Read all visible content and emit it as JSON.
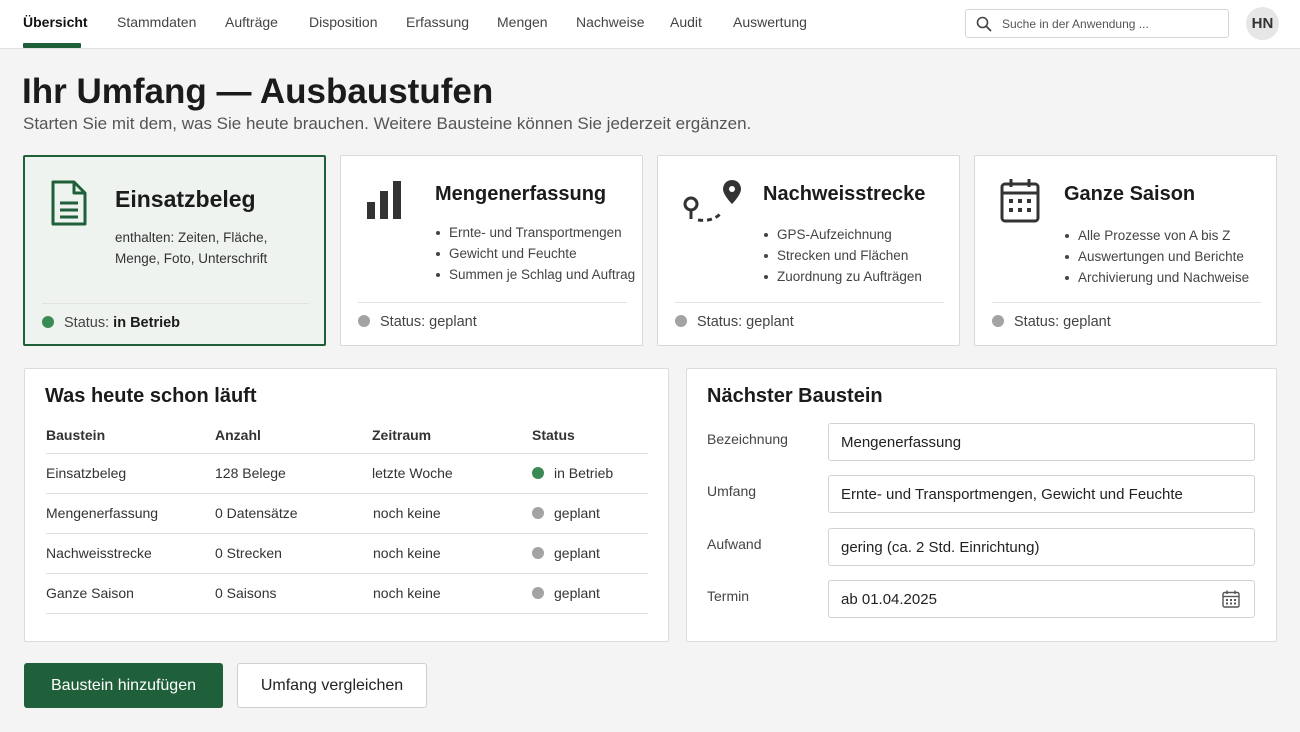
{
  "nav": {
    "items": [
      {
        "label": "Übersicht",
        "active": true
      },
      {
        "label": "Stammdaten"
      },
      {
        "label": "Aufträge"
      },
      {
        "label": "Disposition"
      },
      {
        "label": "Erfassung"
      },
      {
        "label": "Mengen"
      },
      {
        "label": "Nachweise"
      },
      {
        "label": "Audit"
      },
      {
        "label": "Auswertung"
      }
    ],
    "search_placeholder": "Suche in der Anwendung ...",
    "avatar_initials": "HN",
    "accent_color": "#1f5f3a"
  },
  "header": {
    "title": "Ihr Umfang — Ausbaustufen",
    "subtitle": "Starten Sie mit dem, was Sie heute brauchen. Weitere Bausteine können Sie jederzeit ergänzen."
  },
  "cards": [
    {
      "icon": "document-icon",
      "title": "Einsatzbeleg",
      "description": "enthalten: Zeiten, Fläche, Menge, Foto, Unterschrift",
      "status_label": "Status:",
      "status_value": "in Betrieb",
      "status_color": "#3b8a55",
      "active": true
    },
    {
      "icon": "bar-chart-icon",
      "title": "Mengenerfassung",
      "bullets": [
        "Ernte- und Transportmengen",
        "Gewicht und Feuchte",
        "Summen je Schlag und Auftrag"
      ],
      "status_label": "Status:",
      "status_value": "geplant",
      "status_color": "#a3a3a3"
    },
    {
      "icon": "route-pin-icon",
      "title": "Nachweisstrecke",
      "bullets": [
        "GPS-Aufzeichnung",
        "Strecken und Flächen",
        "Zuordnung zu Aufträgen"
      ],
      "status_label": "Status:",
      "status_value": "geplant",
      "status_color": "#a3a3a3"
    },
    {
      "icon": "calendar-icon",
      "title": "Ganze Saison",
      "bullets": [
        "Alle Prozesse von A bis Z",
        "Auswertungen und Berichte",
        "Archivierung und Nachweise"
      ],
      "status_label": "Status:",
      "status_value": "geplant",
      "status_color": "#a3a3a3"
    }
  ],
  "running": {
    "title": "Was heute schon läuft",
    "columns": [
      "Baustein",
      "Anzahl",
      "Zeitraum",
      "Status"
    ],
    "rows": [
      {
        "baustein": "Einsatzbeleg",
        "anzahl": "128 Belege",
        "zeitraum": "letzte Woche",
        "status": "in Betrieb",
        "status_color": "#3b8a55"
      },
      {
        "baustein": "Mengenerfassung",
        "anzahl": "0 Datensätze",
        "zeitraum": "noch keine",
        "status": "geplant",
        "status_color": "#a3a3a3"
      },
      {
        "baustein": "Nachweisstrecke",
        "anzahl": "0 Strecken",
        "zeitraum": "noch keine",
        "status": "geplant",
        "status_color": "#a3a3a3"
      },
      {
        "baustein": "Ganze Saison",
        "anzahl": "0 Saisons",
        "zeitraum": "noch keine",
        "status": "geplant",
        "status_color": "#a3a3a3"
      }
    ]
  },
  "next": {
    "title": "Nächster Baustein",
    "fields": [
      {
        "label": "Bezeichnung",
        "value": "Mengenerfassung"
      },
      {
        "label": "Umfang",
        "value": "Ernte- und Transportmengen, Gewicht und Feuchte"
      },
      {
        "label": "Aufwand",
        "value": "gering (ca. 2 Std. Einrichtung)"
      },
      {
        "label": "Termin",
        "value": "ab 01.04.2025"
      }
    ]
  },
  "actions": {
    "primary_label": "Baustein hinzufügen",
    "secondary_label": "Umfang vergleichen"
  }
}
